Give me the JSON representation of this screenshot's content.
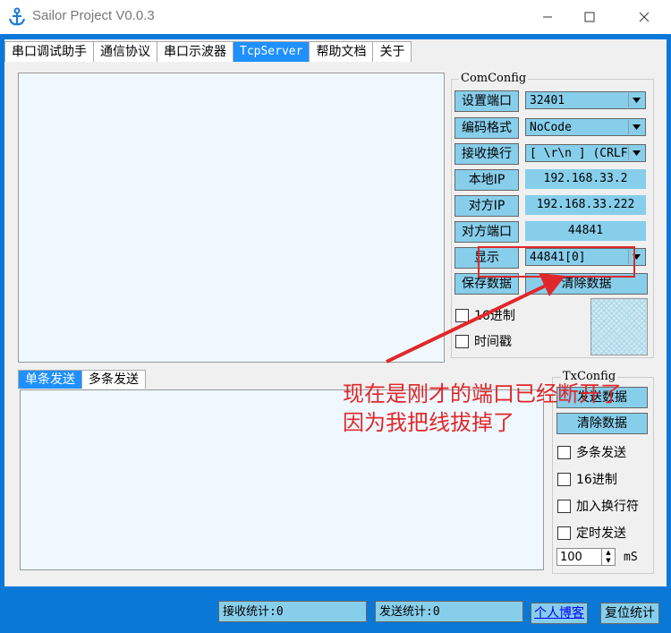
{
  "window": {
    "title": "Sailor Project V0.0.3"
  },
  "tabs": [
    "串口调试助手",
    "通信协议",
    "串口示波器",
    "TcpServer",
    "帮助文档",
    "关于"
  ],
  "active_tab": "TcpServer",
  "com_config": {
    "title": "ComConfig",
    "set_port_label": "设置端口",
    "set_port_value": "32401",
    "encoding_label": "编码格式",
    "encoding_value": "NoCode",
    "newline_label": "接收换行",
    "newline_value": "[ \\r\\n ] (CRLF)",
    "local_ip_label": "本地IP",
    "local_ip_value": "192.168.33.2",
    "remote_ip_label": "对方IP",
    "remote_ip_value": "192.168.33.222",
    "remote_port_label": "对方端口",
    "remote_port_value": "44841",
    "display_label": "显示",
    "display_value": "44841[0]",
    "save_data_label": "保存数据",
    "clear_data_label": "清除数据",
    "hex_label": "16进制",
    "timestamp_label": "时间戳"
  },
  "send_tabs": [
    "单条发送",
    "多条发送"
  ],
  "tx_config": {
    "title": "TxConfig",
    "send_label": "发送数据",
    "clear_label": "清除数据",
    "multi_send_label": "多条发送",
    "hex_label": "16进制",
    "add_newline_label": "加入换行符",
    "timed_send_label": "定时发送",
    "interval_value": "100",
    "interval_unit": "mS"
  },
  "status": {
    "recv_stats": "接收统计:0",
    "send_stats": "发送统计:0",
    "blog_link": "个人博客",
    "reset_stats": "复位统计"
  },
  "annotation": {
    "line1": "现在是刚才的端口已经断开了",
    "line2": "因为我把线拔掉了",
    "color": "#e0282a"
  }
}
